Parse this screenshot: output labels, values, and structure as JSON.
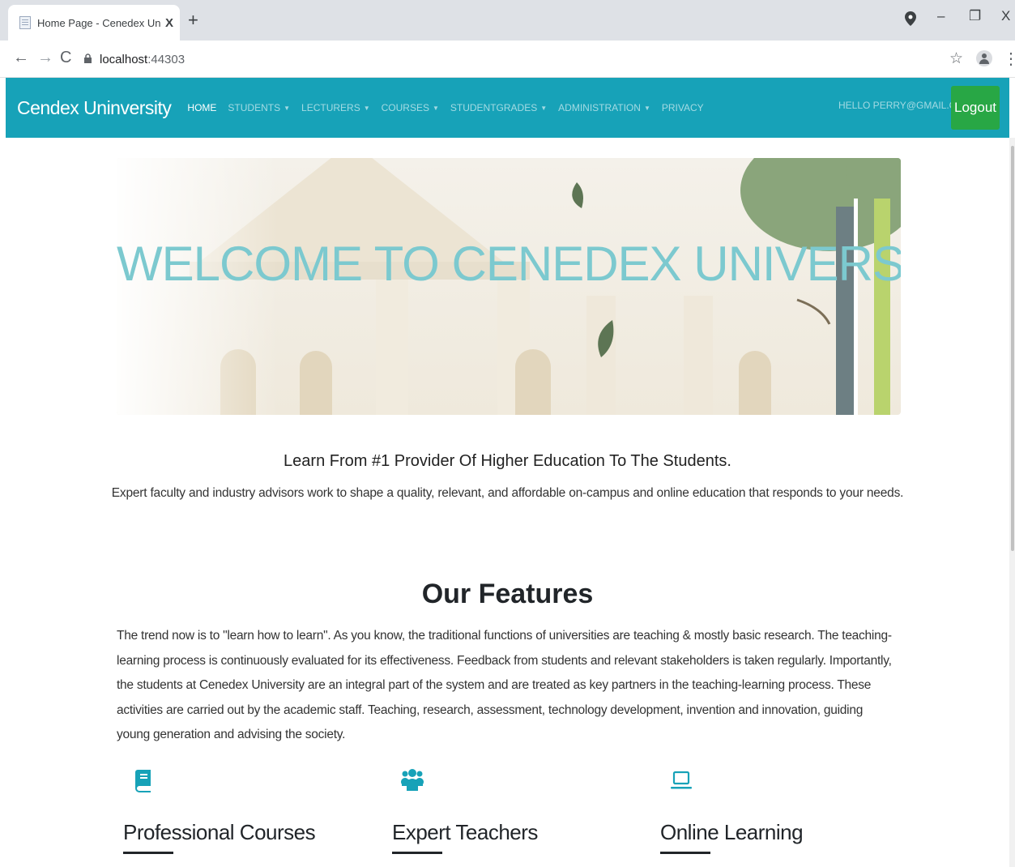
{
  "browser": {
    "tab_title": "Home Page - Cenedex University",
    "tab_close": "X",
    "new_tab": "+",
    "url_host": "localhost",
    "url_port": ":44303",
    "window_controls": [
      "–",
      "❐",
      "X"
    ]
  },
  "navbar": {
    "brand": "Cendex Uninversity",
    "links": [
      {
        "label": "Home",
        "dropdown": false,
        "active": true
      },
      {
        "label": "Students",
        "dropdown": true,
        "active": false
      },
      {
        "label": "Lecturers",
        "dropdown": true,
        "active": false
      },
      {
        "label": "Courses",
        "dropdown": true,
        "active": false
      },
      {
        "label": "StudentGrades",
        "dropdown": true,
        "active": false
      },
      {
        "label": "Administration",
        "dropdown": true,
        "active": false
      },
      {
        "label": "Privacy",
        "dropdown": false,
        "active": false
      }
    ],
    "greeting": "Hello perry@gmail.com!",
    "logout_label": "Logout"
  },
  "hero": {
    "title": "WELCOME TO CENEDEX UNIVERSITY"
  },
  "intro": {
    "heading": "Learn From #1 Provider Of Higher Education To The Students.",
    "text": "Expert faculty and industry advisors work to shape a quality, relevant, and affordable on-campus and online education that responds to your needs."
  },
  "features": {
    "title": "Our Features",
    "text": "The trend now is to \"learn how to learn\". As you know, the traditional functions of universities are teaching & mostly basic research. The teaching-learning process is continuously evaluated for its effectiveness. Feedback from students and relevant stakeholders is taken regularly. Importantly, the students at Cenedex University are an integral part of the system and are treated as key partners in the teaching-learning process. These activities are carried out by the academic staff. Teaching, research, assessment, technology development, invention and innovation, guiding young generation and advising the society.",
    "items": [
      {
        "title": "Professional Courses",
        "icon": "book-icon"
      },
      {
        "title": "Expert Teachers",
        "icon": "users-icon"
      },
      {
        "title": "Online Learning",
        "icon": "laptop-icon"
      }
    ]
  },
  "colors": {
    "navbar": "#17a2b8",
    "logout": "#28a745",
    "hero_title": "#7cc9cf",
    "feature_icon": "#17a2b8"
  }
}
